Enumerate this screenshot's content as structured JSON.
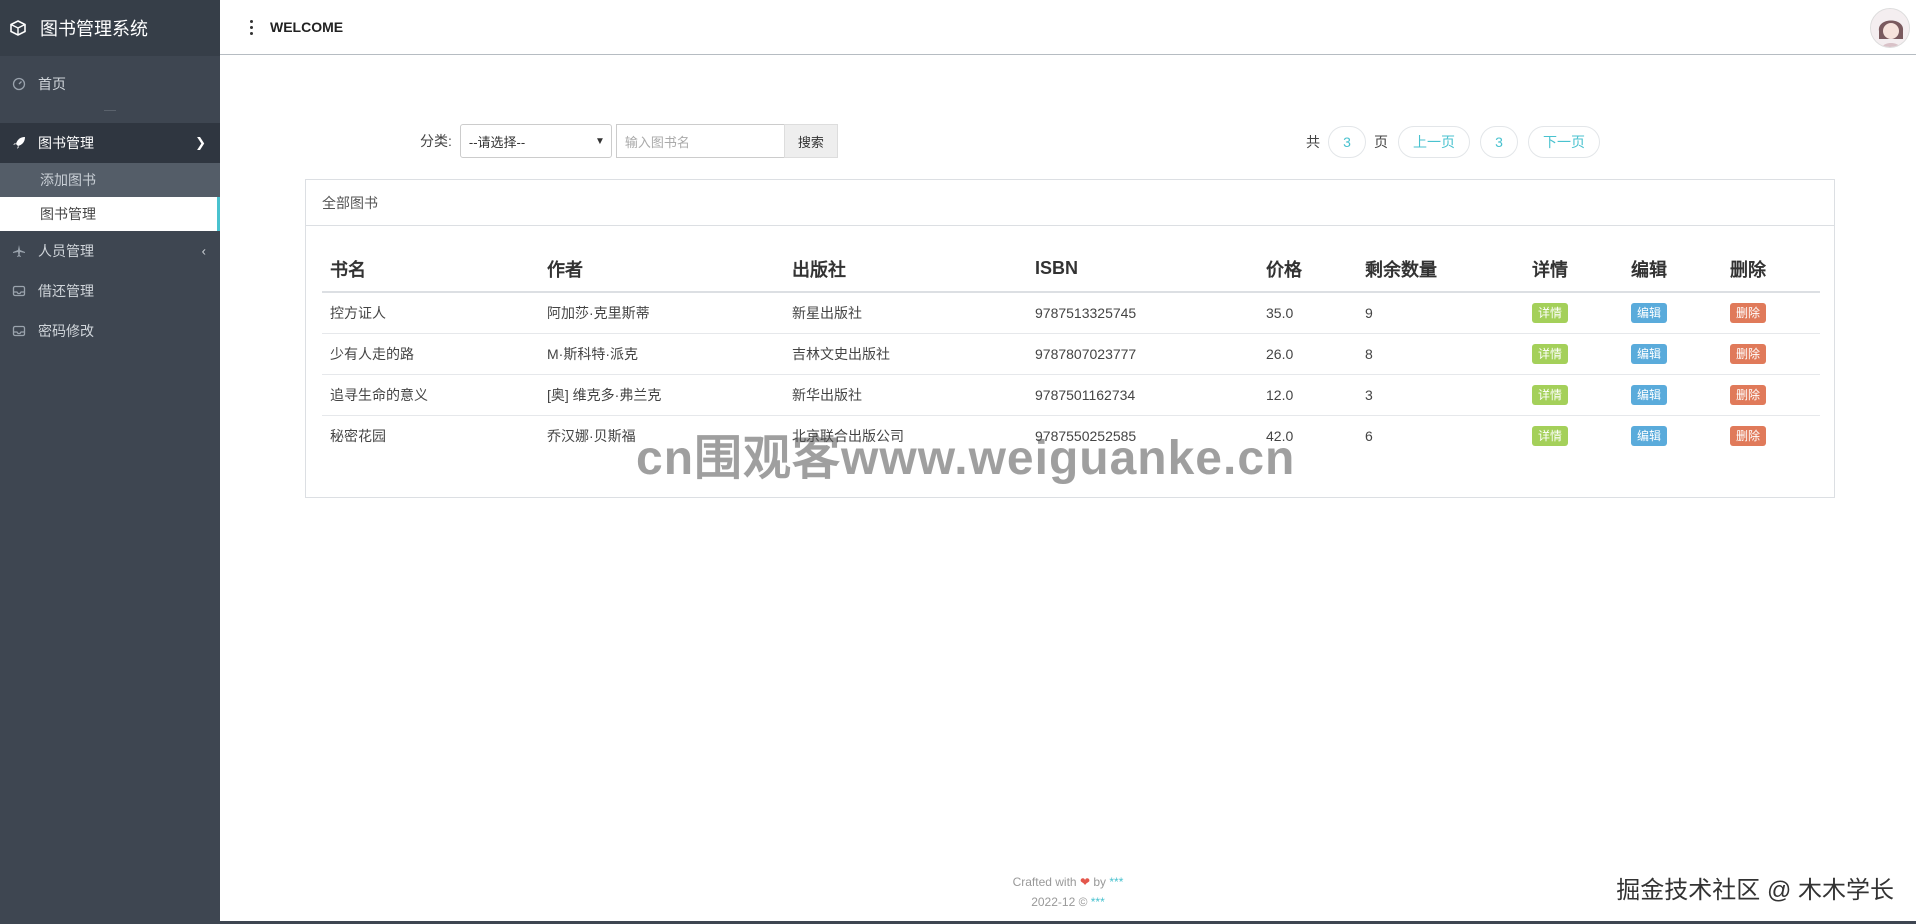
{
  "app": {
    "title": "图书管理系统"
  },
  "sidebar": {
    "home": "首页",
    "book_mgmt": "图书管理",
    "sub_items": [
      "添加图书",
      "图书管理"
    ],
    "people_mgmt": "人员管理",
    "borrow_mgmt": "借还管理",
    "password": "密码修改"
  },
  "topbar": {
    "welcome": "WELCOME"
  },
  "search": {
    "category_label": "分类:",
    "category_value": "--请选择--",
    "placeholder": "输入图书名",
    "button": "搜索"
  },
  "pager": {
    "total_prefix": "共",
    "total_pages": "3",
    "total_suffix": "页",
    "prev": "上一页",
    "current": "3",
    "next": "下一页"
  },
  "panel": {
    "title": "全部图书",
    "columns": [
      "书名",
      "作者",
      "出版社",
      "ISBN",
      "价格",
      "剩余数量",
      "详情",
      "编辑",
      "删除"
    ],
    "rows": [
      {
        "name": "控方证人",
        "author": "阿加莎·克里斯蒂",
        "publisher": "新星出版社",
        "isbn": "9787513325745",
        "price": "35.0",
        "stock": "9"
      },
      {
        "name": "少有人走的路",
        "author": "M·斯科特·派克",
        "publisher": "吉林文史出版社",
        "isbn": "9787807023777",
        "price": "26.0",
        "stock": "8"
      },
      {
        "name": "追寻生命的意义",
        "author": "[奥] 维克多·弗兰克",
        "publisher": "新华出版社",
        "isbn": "9787501162734",
        "price": "12.0",
        "stock": "3"
      },
      {
        "name": "秘密花园",
        "author": "乔汉娜·贝斯福",
        "publisher": "北京联合出版公司",
        "isbn": "9787550252585",
        "price": "42.0",
        "stock": "6"
      }
    ],
    "actions": {
      "detail": "详情",
      "edit": "编辑",
      "delete": "删除"
    }
  },
  "footer": {
    "crafted": "Crafted with",
    "by": "by",
    "author": "***",
    "date": "2022-12 ©",
    "owner": "***"
  },
  "watermarks": {
    "center": "cn围观客www.weiguanke.cn",
    "corner": "掘金技术社区 @ 木木学长"
  },
  "colors": {
    "sidebar_bg": "#3e4651",
    "accent": "#49c2cf",
    "detail": "#a4d05a",
    "edit": "#5aabdb",
    "delete": "#e07a5a"
  }
}
